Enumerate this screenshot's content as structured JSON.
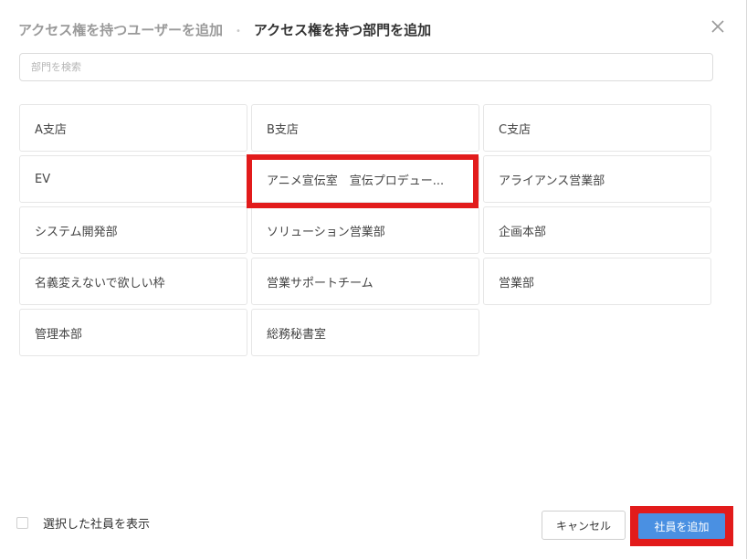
{
  "header": {
    "step1": "アクセス権を持つユーザーを追加",
    "separator": "•",
    "step2": "アクセス権を持つ部門を追加"
  },
  "search": {
    "placeholder": "部門を検索",
    "value": ""
  },
  "departments": [
    "A支店",
    "B支店",
    "C支店",
    "EV",
    "アニメ宣伝室　宣伝プロデュー...",
    "アライアンス営業部",
    "システム開発部",
    "ソリューション営業部",
    "企画本部",
    "名義変えないで欲しい枠",
    "営業サポートチーム",
    "営業部",
    "管理本部",
    "総務秘書室"
  ],
  "footer": {
    "show_selected_label": "選択した社員を表示",
    "show_selected_checked": false,
    "cancel_label": "キャンセル",
    "add_label": "社員を追加"
  },
  "colors": {
    "primary": "#4a90e2",
    "highlight": "#e21b1b"
  }
}
